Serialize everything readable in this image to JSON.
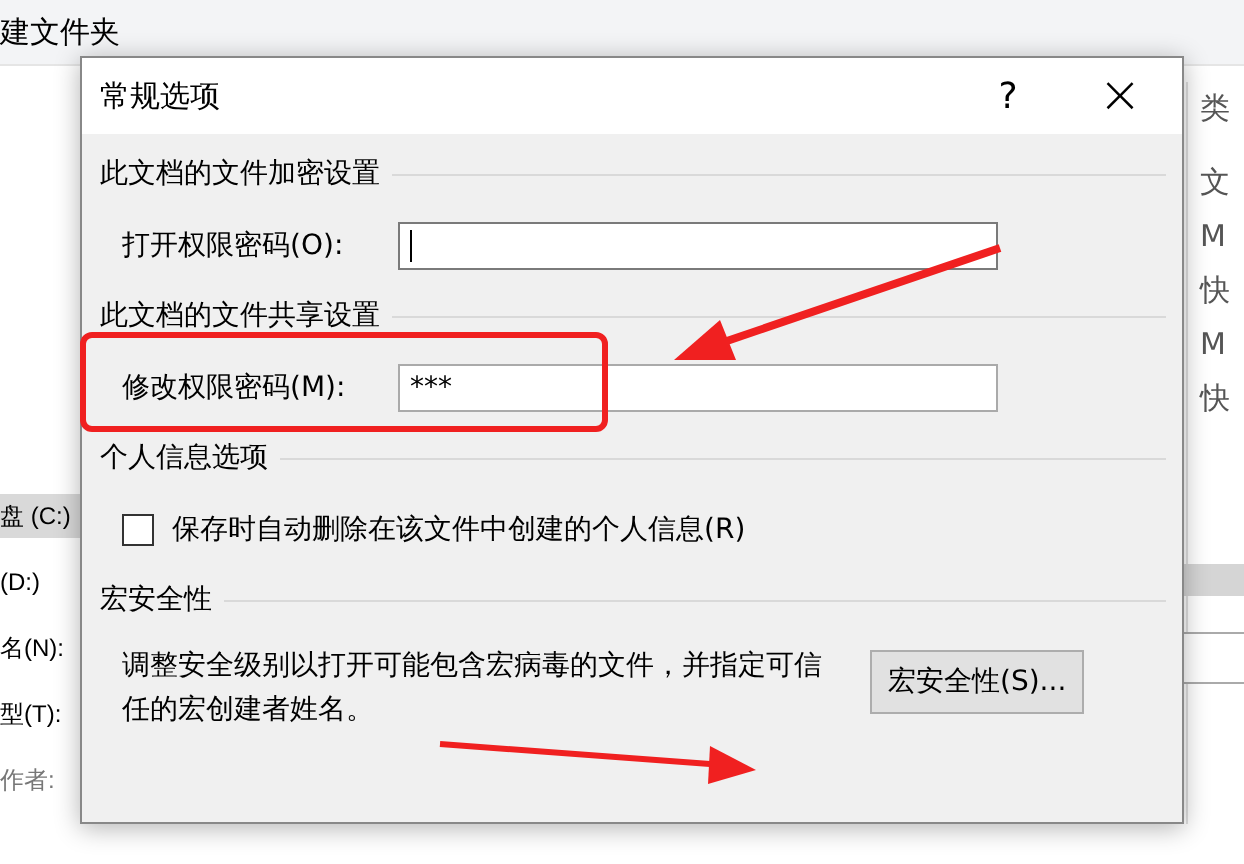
{
  "background_window": {
    "toolbar_text": "建文件夹",
    "left_labels": [
      {
        "text": "盘 (C:)",
        "selected": true
      },
      {
        "text": "(D:)",
        "selected": false
      },
      {
        "text": "名(N):",
        "selected": false
      },
      {
        "text": "型(T):",
        "selected": false
      },
      {
        "text": "作者:",
        "selected": false
      }
    ],
    "right_labels": [
      "类",
      "文",
      "M",
      "快",
      "M",
      "快"
    ]
  },
  "dialog": {
    "title": "常规选项",
    "help": "?",
    "close": "×",
    "sections": [
      {
        "kind": "password",
        "heading": "此文档的文件加密设置",
        "label": "打开权限密码(O):",
        "focused": true
      },
      {
        "kind": "password",
        "heading": "此文档的文件共享设置",
        "label": "修改权限密码(M):",
        "value": "***",
        "focused": false
      },
      {
        "kind": "checkbox",
        "heading": "个人信息选项",
        "label": "保存时自动删除在该文件中创建的个人信息(R)",
        "checked": false
      },
      {
        "kind": "macro",
        "heading": "宏安全性",
        "text": "调整安全级别以打开可能包含宏病毒的文件，并指定可信任的宏创建者姓名。",
        "button": "宏安全性(S)..."
      }
    ]
  }
}
